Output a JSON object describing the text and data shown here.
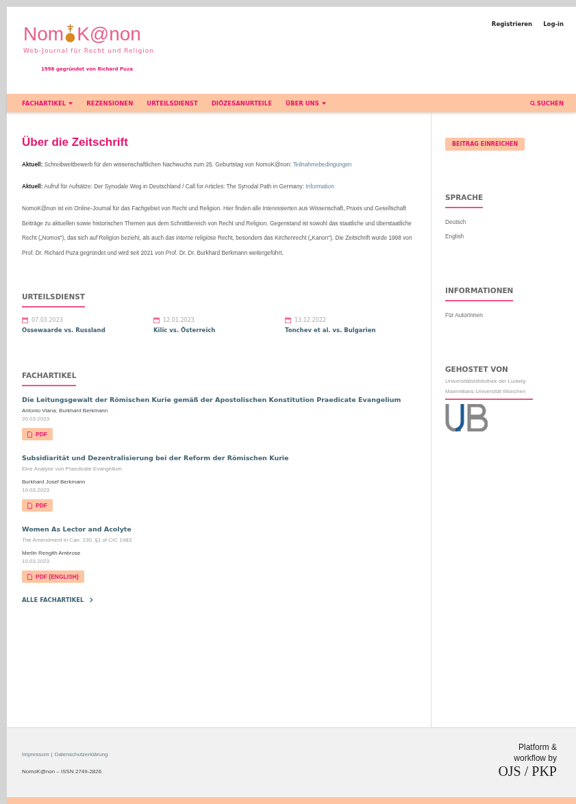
{
  "header": {
    "logo_left": "Nom",
    "logo_right": "K@non",
    "tagline": "Web-Journal für Recht und Religion",
    "founded": "1998 gegründet von Richard Puza",
    "user_links": [
      "Registrieren",
      "Log-in"
    ]
  },
  "nav": {
    "items": [
      {
        "label": "FACHARTIKEL",
        "has_menu": true
      },
      {
        "label": "REZENSIONEN",
        "has_menu": false
      },
      {
        "label": "URTEILSDIENST",
        "has_menu": false
      },
      {
        "label": "DIÖZESANURTEILE",
        "has_menu": false
      },
      {
        "label": "ÜBER UNS",
        "has_menu": true
      }
    ],
    "search": "SUCHEN"
  },
  "main": {
    "title": "Über die Zeitschrift",
    "notices": [
      {
        "label": "Aktuell:",
        "text": "Schreibwettbewerb für den wissenschaftlichen Nachwuchs zum 25. Geburtstag von NomoK@non:",
        "link": "Teilnahmebedingungen"
      },
      {
        "label": "Aktuell:",
        "text": "Aufruf für Aufsätze: Der Synodale Weg in Deutschland / Call for Articles: The Synodal Path in Germany:",
        "link": "Information"
      }
    ],
    "about": "NomoK@non ist ein Online-Journal für das Fachgebiet von Recht und Religion. Hier finden alle Interessierten aus Wissenschaft, Praxis und Gesellschaft Beiträge zu aktuellen sowie historischen Themen aus dem Schnittbereich von Recht und Religion. Gegenstand ist sowohl das staatliche und überstaatliche Recht („Nomos“), das sich auf Religion bezieht, als auch das interne religiöse Recht, besonders das Kirchenrecht („Kanon“). Die Zeitschrift wurde 1998 von Prof. Dr. Richard Puza gegründet und wird seit 2021 von Prof. Dr. Dr. Burkhard Berkmann weitergeführt.",
    "rulings": {
      "heading": "URTEILSDIENST",
      "items": [
        {
          "date": "07.03.2023",
          "title": "Ossewaarde vs. Russland"
        },
        {
          "date": "12.01.2023",
          "title": "Kilic vs. Österreich"
        },
        {
          "date": "13.12.2022",
          "title": "Tonchev et al. vs. Bulgarien"
        }
      ]
    },
    "articles": {
      "heading": "FACHARTIKEL",
      "items": [
        {
          "title": "Die Leitungsgewalt der Römischen Kurie gemäß der Apostolischen Konstitution Praedicate Evangelium",
          "authors": "Antonio Viana; Burkhard Berkmann",
          "date": "20.03.2023",
          "file": "PDF"
        },
        {
          "title": "Subsidiarität und Dezentralisierung bei der Reform der Römischen Kurie",
          "subtitle": "Eine Analyse von Praedicate Evangelium",
          "authors": "Burkhard Josef Berkmann",
          "date": "19.03.2023",
          "file": "PDF"
        },
        {
          "title": "Women As Lector and Acolyte",
          "subtitle": "The Amendment in Can. 230, §1 of CIC 1983",
          "authors": "Merlin Rengith Ambrose",
          "date": "10.03.2023",
          "file": "PDF (ENGLISH)"
        }
      ],
      "more": "ALLE FACHARTIKEL"
    }
  },
  "sidebar": {
    "submit": "BEITRAG EINREICHEN",
    "language": {
      "heading": "SPRACHE",
      "items": [
        "Deutsch",
        "English"
      ]
    },
    "info": {
      "heading": "INFORMATIONEN",
      "items": [
        "Für AutorInnen"
      ]
    },
    "host": {
      "heading": "GEHOSTET VON",
      "text": "Universitätsbibliothek der Ludwig-Maximilians-Universität München"
    }
  },
  "footer": {
    "links": [
      "Impressum",
      "Datenschutzerklärung"
    ],
    "separator": "|",
    "issn": "NomoK@non – ISSN 2749-2826",
    "platform": "Platform & workflow by",
    "platform_logo": "OJS / PKP"
  }
}
